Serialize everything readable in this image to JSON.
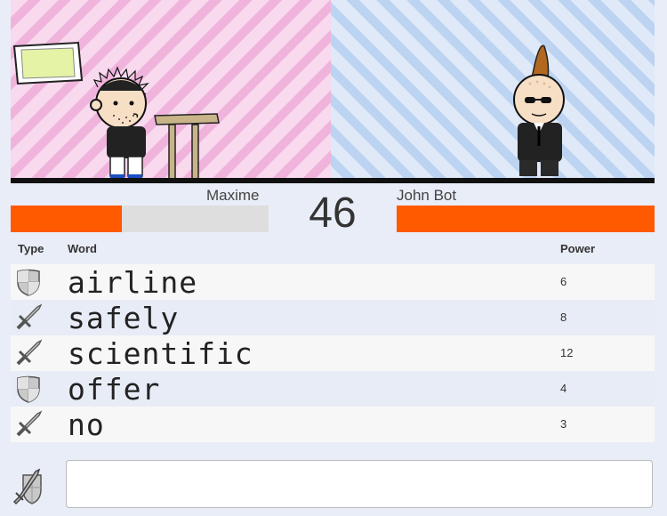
{
  "players": {
    "left": {
      "name": "Maxime",
      "health_fraction": 0.43
    },
    "right": {
      "name": "John Bot",
      "health_fraction": 1.0
    }
  },
  "countdown": "46",
  "columns": {
    "type": "Type",
    "word": "Word",
    "power": "Power"
  },
  "words": [
    {
      "type": "shield-icon",
      "word": "airline",
      "power": "6"
    },
    {
      "type": "sword-icon",
      "word": "safely",
      "power": "8"
    },
    {
      "type": "sword-icon",
      "word": "scientific",
      "power": "12"
    },
    {
      "type": "shield-icon",
      "word": "offer",
      "power": "4"
    },
    {
      "type": "sword-icon",
      "word": "no",
      "power": "3"
    }
  ],
  "input": {
    "value": "",
    "placeholder": ""
  },
  "colors": {
    "health": "#ff5a00",
    "left_bg": "#f0b4dc",
    "right_bg": "#bcd3f1"
  }
}
